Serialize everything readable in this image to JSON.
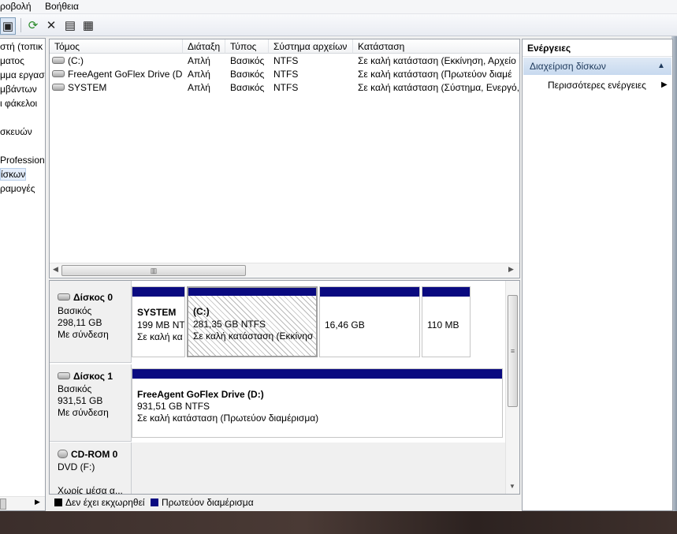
{
  "menubar": {
    "items": [
      "ροβολή",
      "Βοήθεια"
    ]
  },
  "toolbar": {
    "buttons": [
      {
        "name": "console-tree-icon",
        "glyph": "▣"
      },
      {
        "name": "refresh-icon",
        "glyph": "⟳"
      },
      {
        "name": "delete-icon",
        "glyph": "✕"
      },
      {
        "name": "properties-icon",
        "glyph": "▤"
      },
      {
        "name": "help-icon",
        "glyph": "▦"
      }
    ]
  },
  "tree": {
    "items": [
      "στή (τοπικ",
      "ματος",
      "μμα εργασ",
      "μβάντων",
      "ι φάκελοι",
      "",
      "σκευών",
      "",
      "Profession",
      "ίσκων",
      "ραμογές"
    ]
  },
  "volumes": {
    "columns": [
      "Τόμος",
      "Διάταξη",
      "Τύπος",
      "Σύστημα αρχείων",
      "Κατάσταση"
    ],
    "rows": [
      [
        "(C:)",
        "Απλή",
        "Βασικός",
        "NTFS",
        "Σε καλή κατάσταση (Εκκίνηση, Αρχείο"
      ],
      [
        "FreeAgent GoFlex Drive (D:)",
        "Απλή",
        "Βασικός",
        "NTFS",
        "Σε καλή κατάσταση (Πρωτεύον διαμέ"
      ],
      [
        "SYSTEM",
        "Απλή",
        "Βασικός",
        "NTFS",
        "Σε καλή κατάσταση (Σύστημα, Ενεργό,"
      ]
    ]
  },
  "disks": [
    {
      "name": "Δίσκος 0",
      "type": "Βασικός",
      "size": "298,11 GB",
      "status": "Με σύνδεση",
      "partitions": [
        {
          "title": "SYSTEM",
          "size": "199 MB NT",
          "status": "Σε καλή κα"
        },
        {
          "title": "(C:)",
          "size": "281,35 GB NTFS",
          "status": "Σε καλή κατάσταση (Εκκίνησ"
        },
        {
          "title": "",
          "size": "16,46 GB",
          "status": ""
        },
        {
          "title": "",
          "size": "110 MB",
          "status": ""
        }
      ]
    },
    {
      "name": "Δίσκος 1",
      "type": "Βασικός",
      "size": "931,51 GB",
      "status": "Με σύνδεση",
      "partitions": [
        {
          "title": "FreeAgent GoFlex Drive  (D:)",
          "size": "931,51 GB NTFS",
          "status": "Σε καλή κατάσταση (Πρωτεύον διαμέρισμα)"
        }
      ]
    },
    {
      "name": "CD-ROM 0",
      "type": "DVD (F:)",
      "size": "",
      "status": "Χωρίς μέσα α..."
    }
  ],
  "legend": [
    {
      "label": "Δεν έχει εκχωρηθεί",
      "color": "#000000"
    },
    {
      "label": "Πρωτεύον διαμέρισμα",
      "color": "#0a0a80"
    }
  ],
  "actions": {
    "title": "Ενέργειες",
    "section": "Διαχείριση δίσκων",
    "more": "Περισσότερες ενέργειες"
  },
  "scroll": {
    "h_thumb": "▥",
    "v_thumb": "≡"
  }
}
